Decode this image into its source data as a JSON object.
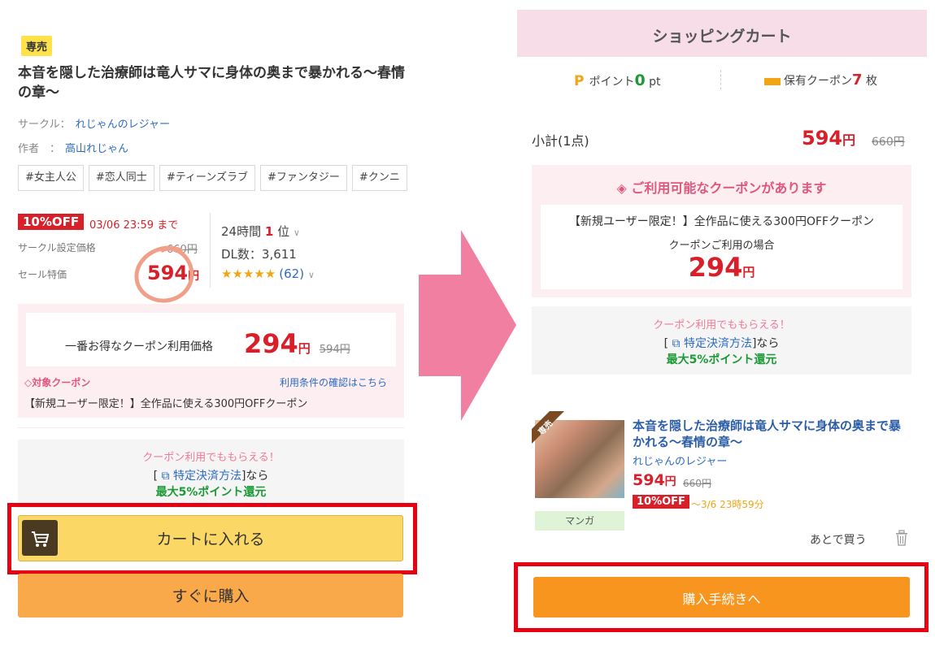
{
  "left": {
    "badge": "専売",
    "title": "本音を隠した治療師は竜人サマに身体の奥まで暴かれる〜春情の章〜",
    "circle_label": "サークル：",
    "circle_name": "れじゃんのレジャー",
    "author_label": "作者　：",
    "author_name": "高山れじゃん",
    "tags": [
      "#女主人公",
      "#恋人同士",
      "#ティーンズラブ",
      "#ファンタジー",
      "#クンニ"
    ],
    "off_badge": "10%OFF",
    "off_until": "03/06 23:59 まで",
    "circle_price_label": "サークル設定価格",
    "circle_price": "660円",
    "sale_label": "セール特価",
    "sale_price": "594",
    "yen": "円",
    "rank_prefix": "24時間",
    "rank_num": "1",
    "rank_suffix": "位",
    "dl": "DL数：3,611",
    "stars": "★★★★★",
    "rating_count": "(62)",
    "best_coupon_label": "一番お得なクーポン利用価格",
    "best_price": "294",
    "best_old": "594円",
    "target_coupon": "対象クーポン",
    "terms_link": "利用条件の確認はこちら",
    "coupon_name": "【新規ユーザー限定！】全作品に使える300円OFFクーポン",
    "coupon_promo": "クーポン利用でももらえる！",
    "payment_pre": "[",
    "payment_link": "特定決済方法",
    "payment_post": "]なら",
    "point_return": "最大5%ポイント還元",
    "cart_button": "カートに入れる",
    "buy_now": "すぐに購入"
  },
  "right": {
    "header": "ショッピングカート",
    "points_label": "ポイント",
    "points_value": "0",
    "points_unit": "pt",
    "coupon_label": "保有クーポン",
    "coupon_count": "7",
    "coupon_unit": "枚",
    "subtotal_label": "小計(1点)",
    "subtotal_price": "594",
    "yen": "円",
    "subtotal_old": "660円",
    "coupon_available": "ご利用可能なクーポンがあります",
    "coupon_name": "【新規ユーザー限定！】全作品に使える300円OFFクーポン",
    "when_using": "クーポンご利用の場合",
    "coupon_price": "294",
    "coupon_promo": "クーポン利用でももらえる！",
    "payment_pre": "[",
    "payment_link": "特定決済方法",
    "payment_post": "]なら",
    "point_return": "最大5%ポイント還元",
    "product_ribbon": "専売",
    "product_title": "本音を隠した治療師は竜人サマに身体の奥まで暴かれる〜春情の章〜",
    "product_circle": "れじゃんのレジャー",
    "product_price": "594",
    "product_old": "660円",
    "product_off": "10%OFF",
    "product_date": "〜3/6 23時59分",
    "product_type": "マンガ",
    "later": "あとで買う",
    "proceed": "購入手続きへ"
  },
  "colors": {
    "price_red": "#d8202a",
    "cart_yellow": "#fbd866",
    "buy_orange": "#f9a84a",
    "proceed_orange": "#f7951f",
    "highlight_red": "#e60012",
    "arrow_pink": "#f07fa2"
  }
}
